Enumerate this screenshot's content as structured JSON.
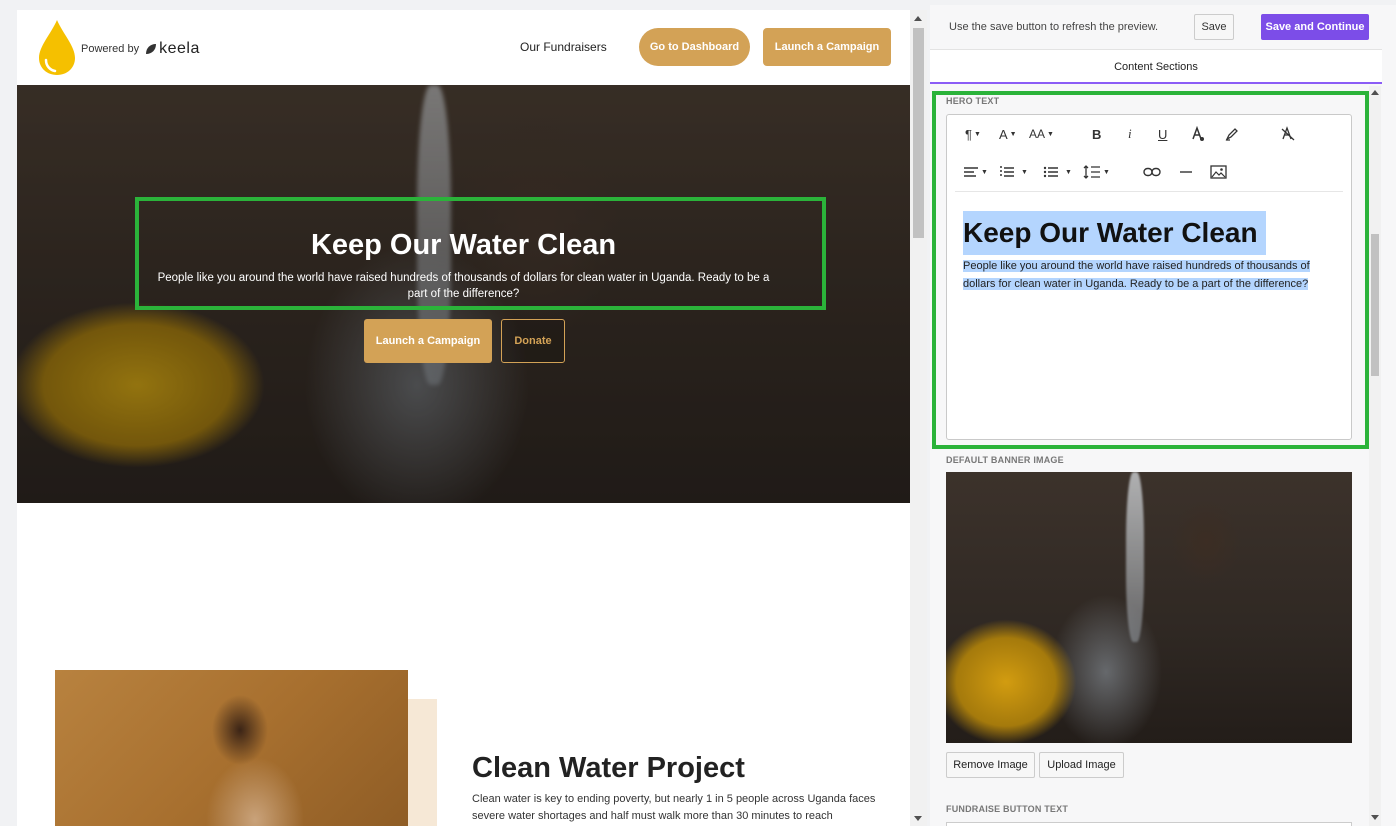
{
  "site": {
    "powered_by": "Powered by",
    "brand": "keela",
    "nav_link": "Our Fundraisers",
    "dashboard_button": "Go to Dashboard",
    "launch_button_top": "Launch a Campaign"
  },
  "hero": {
    "title": "Keep Our Water Clean",
    "subtitle": "People like you around the world have raised hundreds of thousands of dollars for clean water in Uganda. Ready to be a part of the difference?",
    "launch_button": "Launch a Campaign",
    "donate_button": "Donate"
  },
  "project": {
    "title": "Clean Water Project",
    "text": "Clean water is key to ending poverty, but nearly 1 in 5 people across Uganda faces severe water shortages and half must walk more than 30 minutes to reach"
  },
  "editor": {
    "hint": "Use the save button to refresh the preview.",
    "save_button": "Save",
    "save_continue_button": "Save and Continue",
    "tab": "Content Sections",
    "hero_text_label": "HERO TEXT",
    "rte_title": "Keep Our Water Clean",
    "rte_body": "People like you around the world have raised hundreds of thousands of dollars for clean water in Uganda. Ready to be a part of the difference?",
    "banner_label": "DEFAULT BANNER IMAGE",
    "remove_image_button": "Remove Image",
    "upload_image_button": "Upload Image",
    "fundraise_label": "FUNDRAISE BUTTON TEXT",
    "toolbar": {
      "paragraph": "¶",
      "font": "A",
      "size": "AA",
      "bold": "B",
      "italic": "i",
      "underline": "U"
    }
  },
  "colors": {
    "gold": "#d3a256",
    "purple": "#7c4de8",
    "highlight_green": "#2bb33a",
    "selection": "#b4d5fe"
  }
}
